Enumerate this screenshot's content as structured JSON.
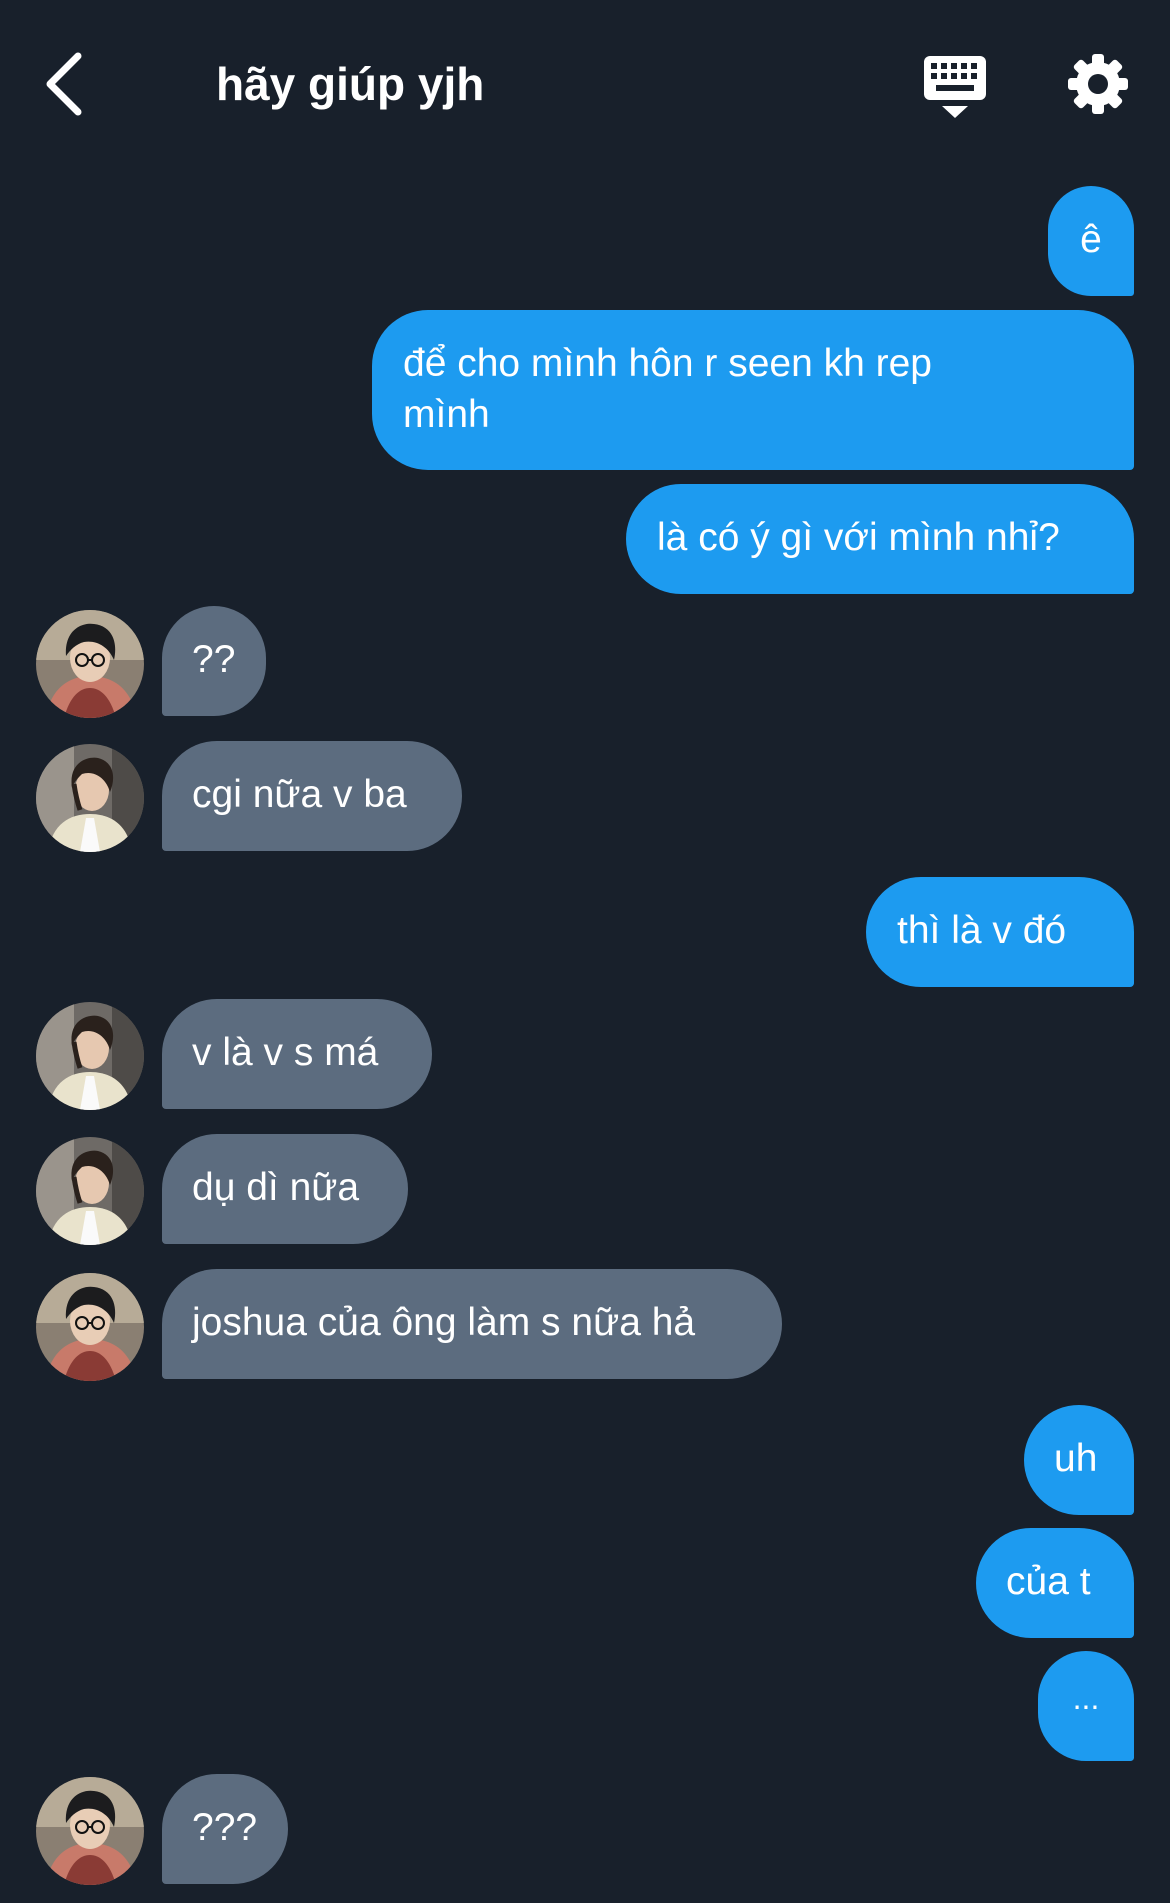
{
  "header": {
    "title": "hãy giúp yjh",
    "back_icon": "chevron-left-icon",
    "keyboard_icon": "keyboard-icon",
    "settings_icon": "gear-icon"
  },
  "colors": {
    "background": "#18202b",
    "outgoing_bubble": "#1d9bf0",
    "incoming_bubble": "#5c6c7f",
    "text": "#ffffff"
  },
  "messages": [
    {
      "side": "out",
      "text": "ê"
    },
    {
      "side": "out",
      "text_line1": "để cho mình hôn r seen kh rep",
      "text_line2": "mình"
    },
    {
      "side": "out",
      "text": "là có ý gì với mình nhỉ?"
    },
    {
      "side": "in",
      "avatar": "avatar-glasses",
      "text": "??"
    },
    {
      "side": "in",
      "avatar": "avatar-cardigan",
      "text": "cgi nữa v ba"
    },
    {
      "side": "out",
      "text": "thì là v đó"
    },
    {
      "side": "in",
      "avatar": "avatar-cardigan",
      "text": "v là v s má"
    },
    {
      "side": "in",
      "avatar": "avatar-cardigan",
      "text": "dụ dì nữa"
    },
    {
      "side": "in",
      "avatar": "avatar-glasses",
      "text": "joshua của ông làm s nữa hả"
    },
    {
      "side": "out",
      "text": "uh"
    },
    {
      "side": "out",
      "text": "của t"
    },
    {
      "side": "out",
      "text": "..."
    },
    {
      "side": "in",
      "avatar": "avatar-glasses",
      "text": "???"
    }
  ]
}
